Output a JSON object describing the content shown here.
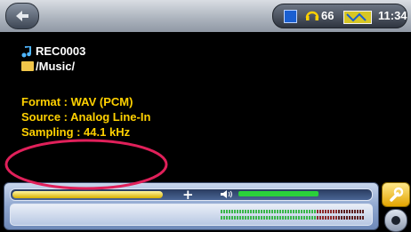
{
  "status": {
    "volume": "66",
    "time": "11:34"
  },
  "file": {
    "name": "REC0003",
    "folder": "/Music/"
  },
  "details": {
    "format": "Format : WAV (PCM)",
    "source": "Source : Analog Line-In",
    "sampling": "Sampling : 44.1 kHz"
  },
  "playback": {
    "progress_fraction": 0.42,
    "volume_fraction": 0.6
  },
  "icons": [
    "back-icon",
    "stop-icon",
    "headphones-icon",
    "battery-icon",
    "music-note-icon",
    "folder-icon",
    "plus-icon",
    "speaker-icon",
    "wrench-icon",
    "dot-icon"
  ],
  "colors": {
    "accent_yellow": "#ffd100",
    "volume_green": "#2ad13a",
    "annotation": "#e0205a"
  }
}
